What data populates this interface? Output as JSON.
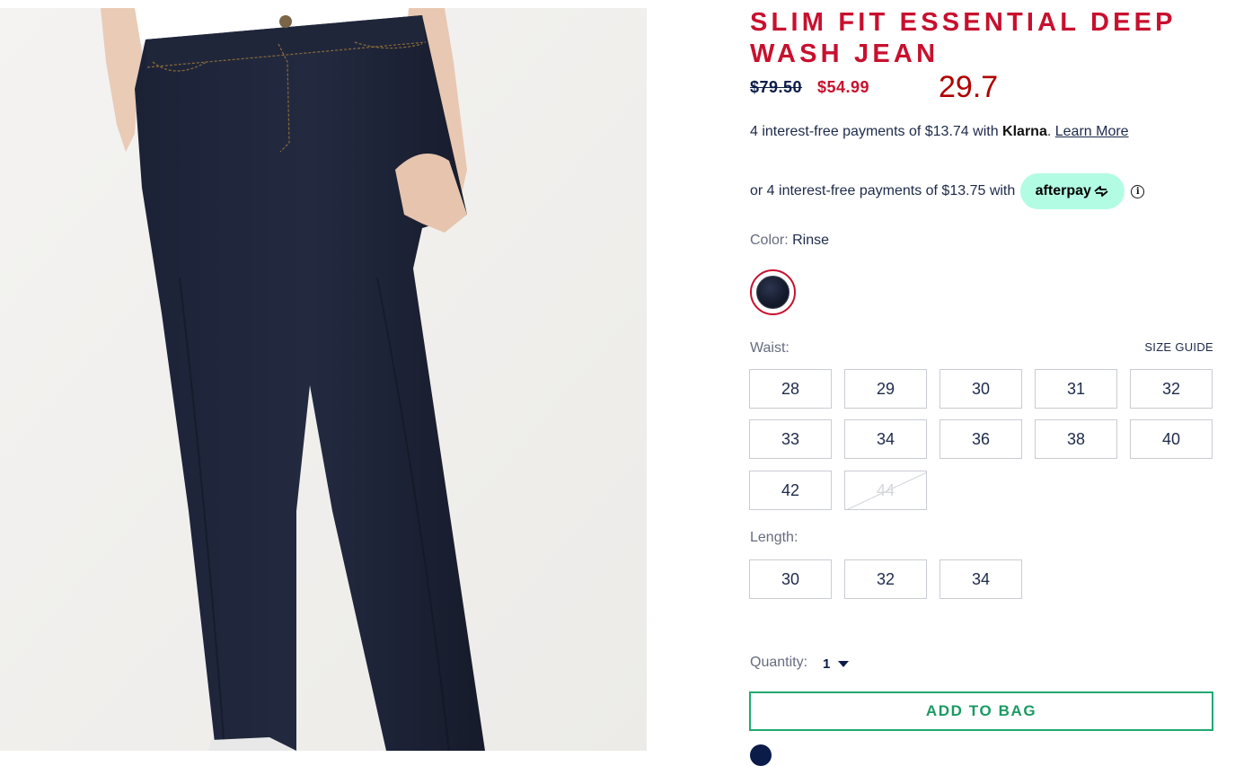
{
  "product": {
    "title": "SLIM FIT ESSENTIAL DEEP WASH JEAN",
    "original_price": "$79.50",
    "sale_price": "$54.99",
    "overlay_number": "29.7"
  },
  "klarna": {
    "text": "4 interest-free payments of $13.74 with ",
    "brand": "Klarna",
    "period": ".",
    "learn_more": "Learn More"
  },
  "afterpay": {
    "text": "or 4 interest-free payments of $13.75 with",
    "brand": "afterpay",
    "info_glyph": "i"
  },
  "color": {
    "label": "Color: ",
    "value": "Rinse",
    "swatch_color": "#141a2b"
  },
  "waist": {
    "label": "Waist:",
    "size_guide": "SIZE GUIDE",
    "sizes": [
      {
        "label": "28",
        "available": true
      },
      {
        "label": "29",
        "available": true
      },
      {
        "label": "30",
        "available": true
      },
      {
        "label": "31",
        "available": true
      },
      {
        "label": "32",
        "available": true
      },
      {
        "label": "33",
        "available": true
      },
      {
        "label": "34",
        "available": true
      },
      {
        "label": "36",
        "available": true
      },
      {
        "label": "38",
        "available": true
      },
      {
        "label": "40",
        "available": true
      },
      {
        "label": "42",
        "available": true
      },
      {
        "label": "44",
        "available": false
      }
    ]
  },
  "length": {
    "label": "Length:",
    "sizes": [
      {
        "label": "30",
        "available": true
      },
      {
        "label": "32",
        "available": true
      },
      {
        "label": "34",
        "available": true
      }
    ]
  },
  "quantity": {
    "label": "Quantity:",
    "value": "1"
  },
  "add_to_bag": "ADD TO BAG",
  "colors": {
    "brand_red": "#c8102e",
    "navy": "#0b1c48",
    "afterpay_mint": "#b2fce4",
    "cta_green": "#1faa70"
  }
}
